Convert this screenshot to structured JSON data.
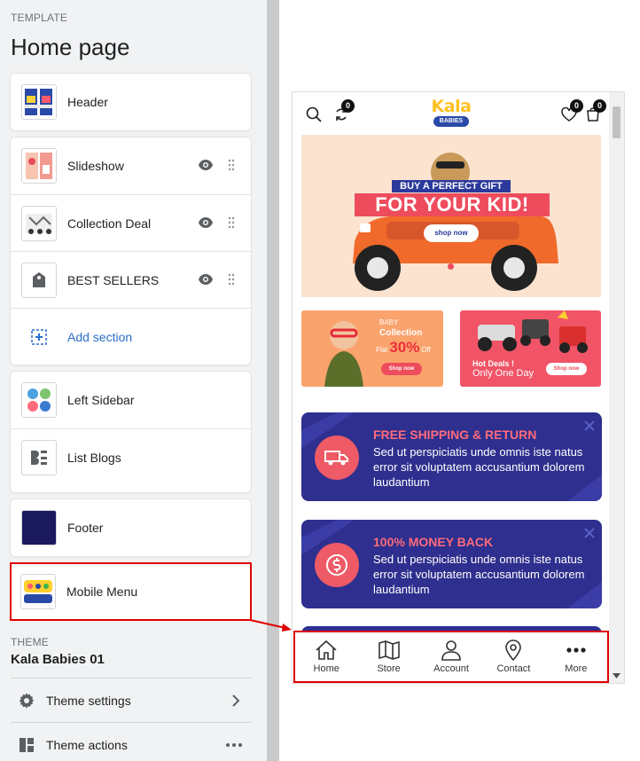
{
  "editor": {
    "template_label": "TEMPLATE",
    "page_title": "Home page",
    "header_section": "Header",
    "sections": [
      "Slideshow",
      "Collection Deal",
      "BEST SELLERS"
    ],
    "add_section": "Add section",
    "left_sidebar": "Left Sidebar",
    "list_blogs": "List Blogs",
    "footer": "Footer",
    "mobile_menu": "Mobile Menu",
    "theme_label": "THEME",
    "theme_name": "Kala Babies 01",
    "theme_settings": "Theme settings",
    "theme_actions": "Theme actions"
  },
  "preview": {
    "logo_top": "Kala",
    "logo_bottom": "BABIES",
    "compare_count": "0",
    "wishlist_count": "0",
    "cart_count": "0",
    "hero": {
      "tagline": "BUY A PERFECT GIFT",
      "headline": "FOR YOUR KID!",
      "button": "shop now"
    },
    "promo_left": {
      "eyebrow": "BABY",
      "title": "Collection",
      "discount_prefix": "Flat",
      "discount": "30%",
      "discount_suffix": "Off",
      "button": "Shop now"
    },
    "promo_right": {
      "title": "Hot Deals !",
      "subtitle": "Only One Day",
      "button": "Shop now"
    },
    "features": [
      {
        "title": "FREE SHIPPING & RETURN",
        "desc": "Sed ut perspiciatis unde omnis iste natus error sit voluptatem accusantium dolorem laudantium"
      },
      {
        "title": "100% MONEY BACK",
        "desc": "Sed ut perspiciatis unde omnis iste natus error sit voluptatem accusantium dolorem laudantium"
      }
    ],
    "mobile_nav": [
      "Home",
      "Store",
      "Account",
      "Contact",
      "More"
    ]
  },
  "colors": {
    "highlight": "#e00000",
    "feature_bg": "#2e2f8e",
    "accent_red": "#ee4c5d",
    "link_blue": "#2c6ecb"
  }
}
